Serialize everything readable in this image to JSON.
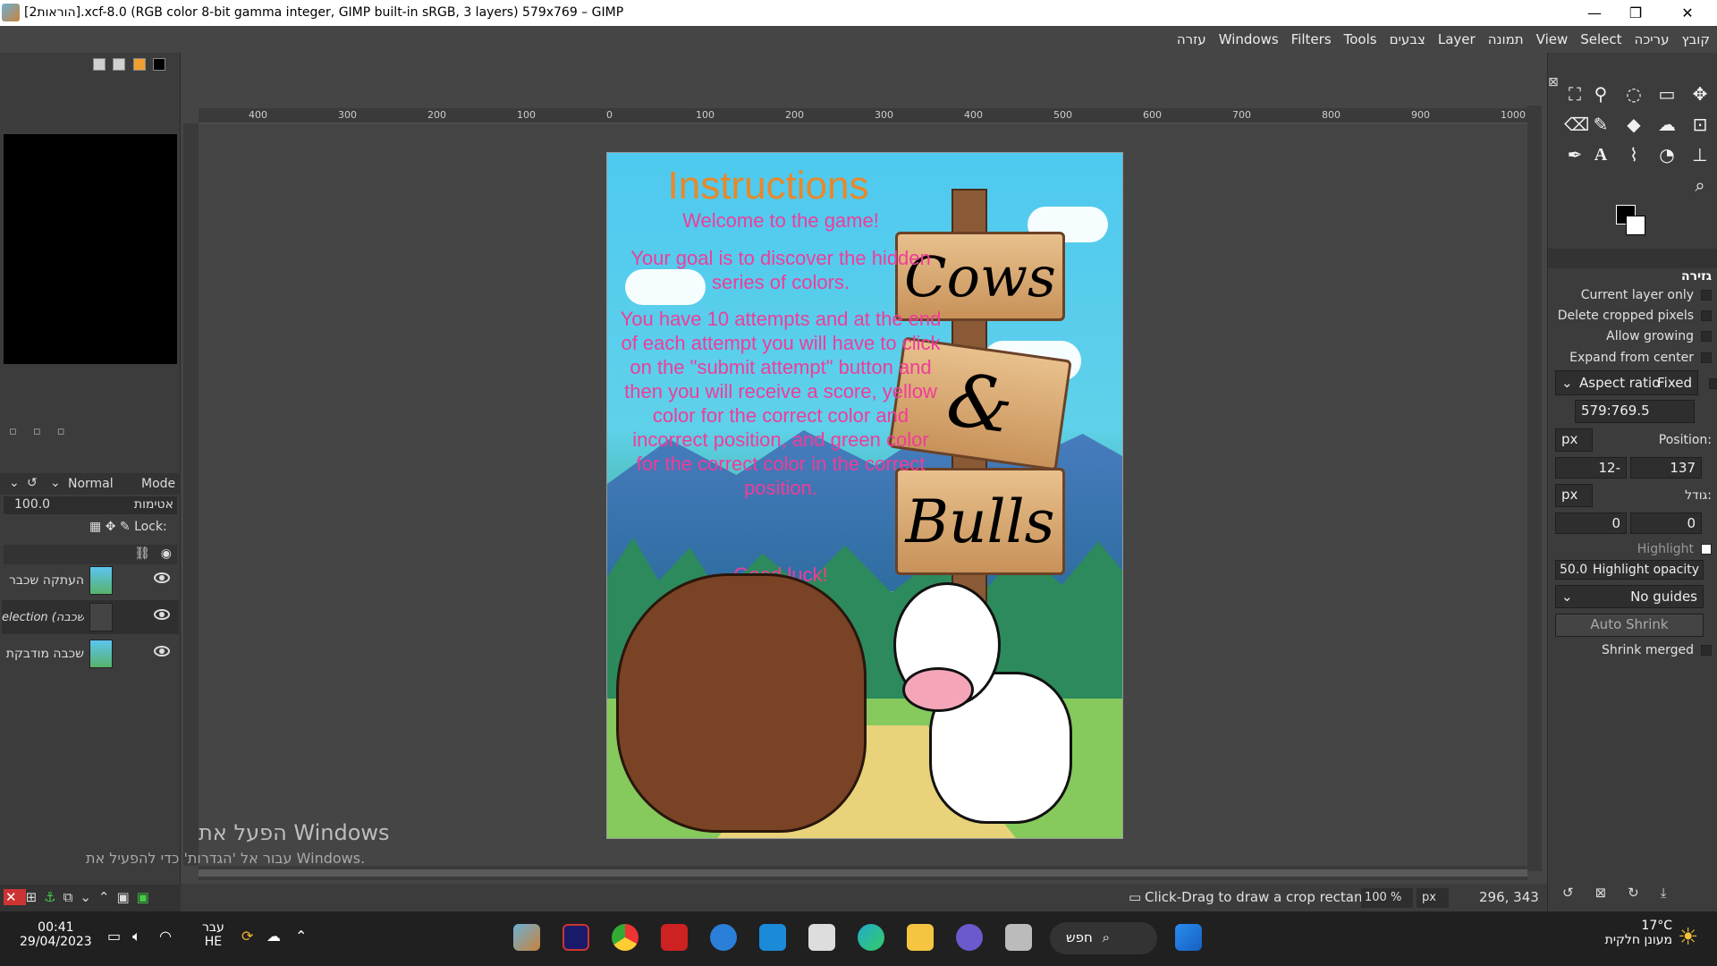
{
  "window": {
    "title": "[הוראות2].xcf-8.0 (RGB color 8-bit gamma integer, GIMP built-in sRGB, 3 layers) 579x769 – GIMP",
    "min_glyph": "—",
    "max_glyph": "❐",
    "close_glyph": "✕"
  },
  "menu": [
    "קובץ",
    "עריכה",
    "Select",
    "View",
    "תמונה",
    "Layer",
    "צבעים",
    "Tools",
    "Filters",
    "Windows",
    "עזרה"
  ],
  "layers_panel": {
    "mode_label": "Normal",
    "mode_caption": "Mode",
    "opacity_value": "100.0",
    "opacity_caption": "אטימות",
    "lock_caption": "Lock:",
    "layers": [
      {
        "name": "העתקה שכבר"
      },
      {
        "name": "election (העתקה שכבה"
      },
      {
        "name": "שכבה מודבקת"
      }
    ]
  },
  "artwork": {
    "title": "Instructions",
    "line1": "Welcome to the game!",
    "line2": "Your goal is to discover the hidden series of colors.",
    "line3": "You have 10 attempts and at the end of each attempt you will have to click on the \"submit attempt\" button and then you will receive a score, yellow color for the correct color and incorrect position, and green color for the correct color in the correct position.",
    "line4": "Good luck!",
    "sign1": "Cows",
    "sign2": "&",
    "sign3": "Bulls"
  },
  "ruler": {
    "labels": [
      "400",
      "300",
      "200",
      "100",
      "0",
      "100",
      "200",
      "300",
      "400",
      "500",
      "600",
      "700",
      "800",
      "900",
      "1000"
    ]
  },
  "tool_options": {
    "header": "גזירה",
    "current_layer_only": "Current layer only",
    "delete_cropped": "Delete cropped pixels",
    "allow_growing": "Allow growing",
    "expand_center": "Expand from center",
    "aspect_label": "Aspect ratio",
    "aspect_mode": "Fixed",
    "aspect_value": "579:769.5",
    "unit": "px",
    "position_label": "Position:",
    "pos_x": "12-",
    "pos_y": "137",
    "size_label": "גודל:",
    "size_w": "0",
    "size_h": "0",
    "highlight_label": "Highlight",
    "highlight_opacity_value": "50.0",
    "highlight_opacity_label": "Highlight opacity",
    "guides": "No guides",
    "auto_shrink": "Auto Shrink",
    "shrink_merged": "Shrink merged"
  },
  "status": {
    "hint": "Click-Drag to draw a crop rectangle",
    "zoom": "100 %",
    "unit": "px",
    "coords": "296, 343"
  },
  "watermark": {
    "line1": "הפעל את Windows",
    "line2": "עבור אל 'הגדרות' כדי להפעיל את Windows."
  },
  "taskbar": {
    "time": "00:41",
    "date": "29/04/2023",
    "lang1": "עבר",
    "lang2": "HE",
    "search": "חפש",
    "weather_temp": "17°C",
    "weather_desc": "מעונן חלקית"
  }
}
